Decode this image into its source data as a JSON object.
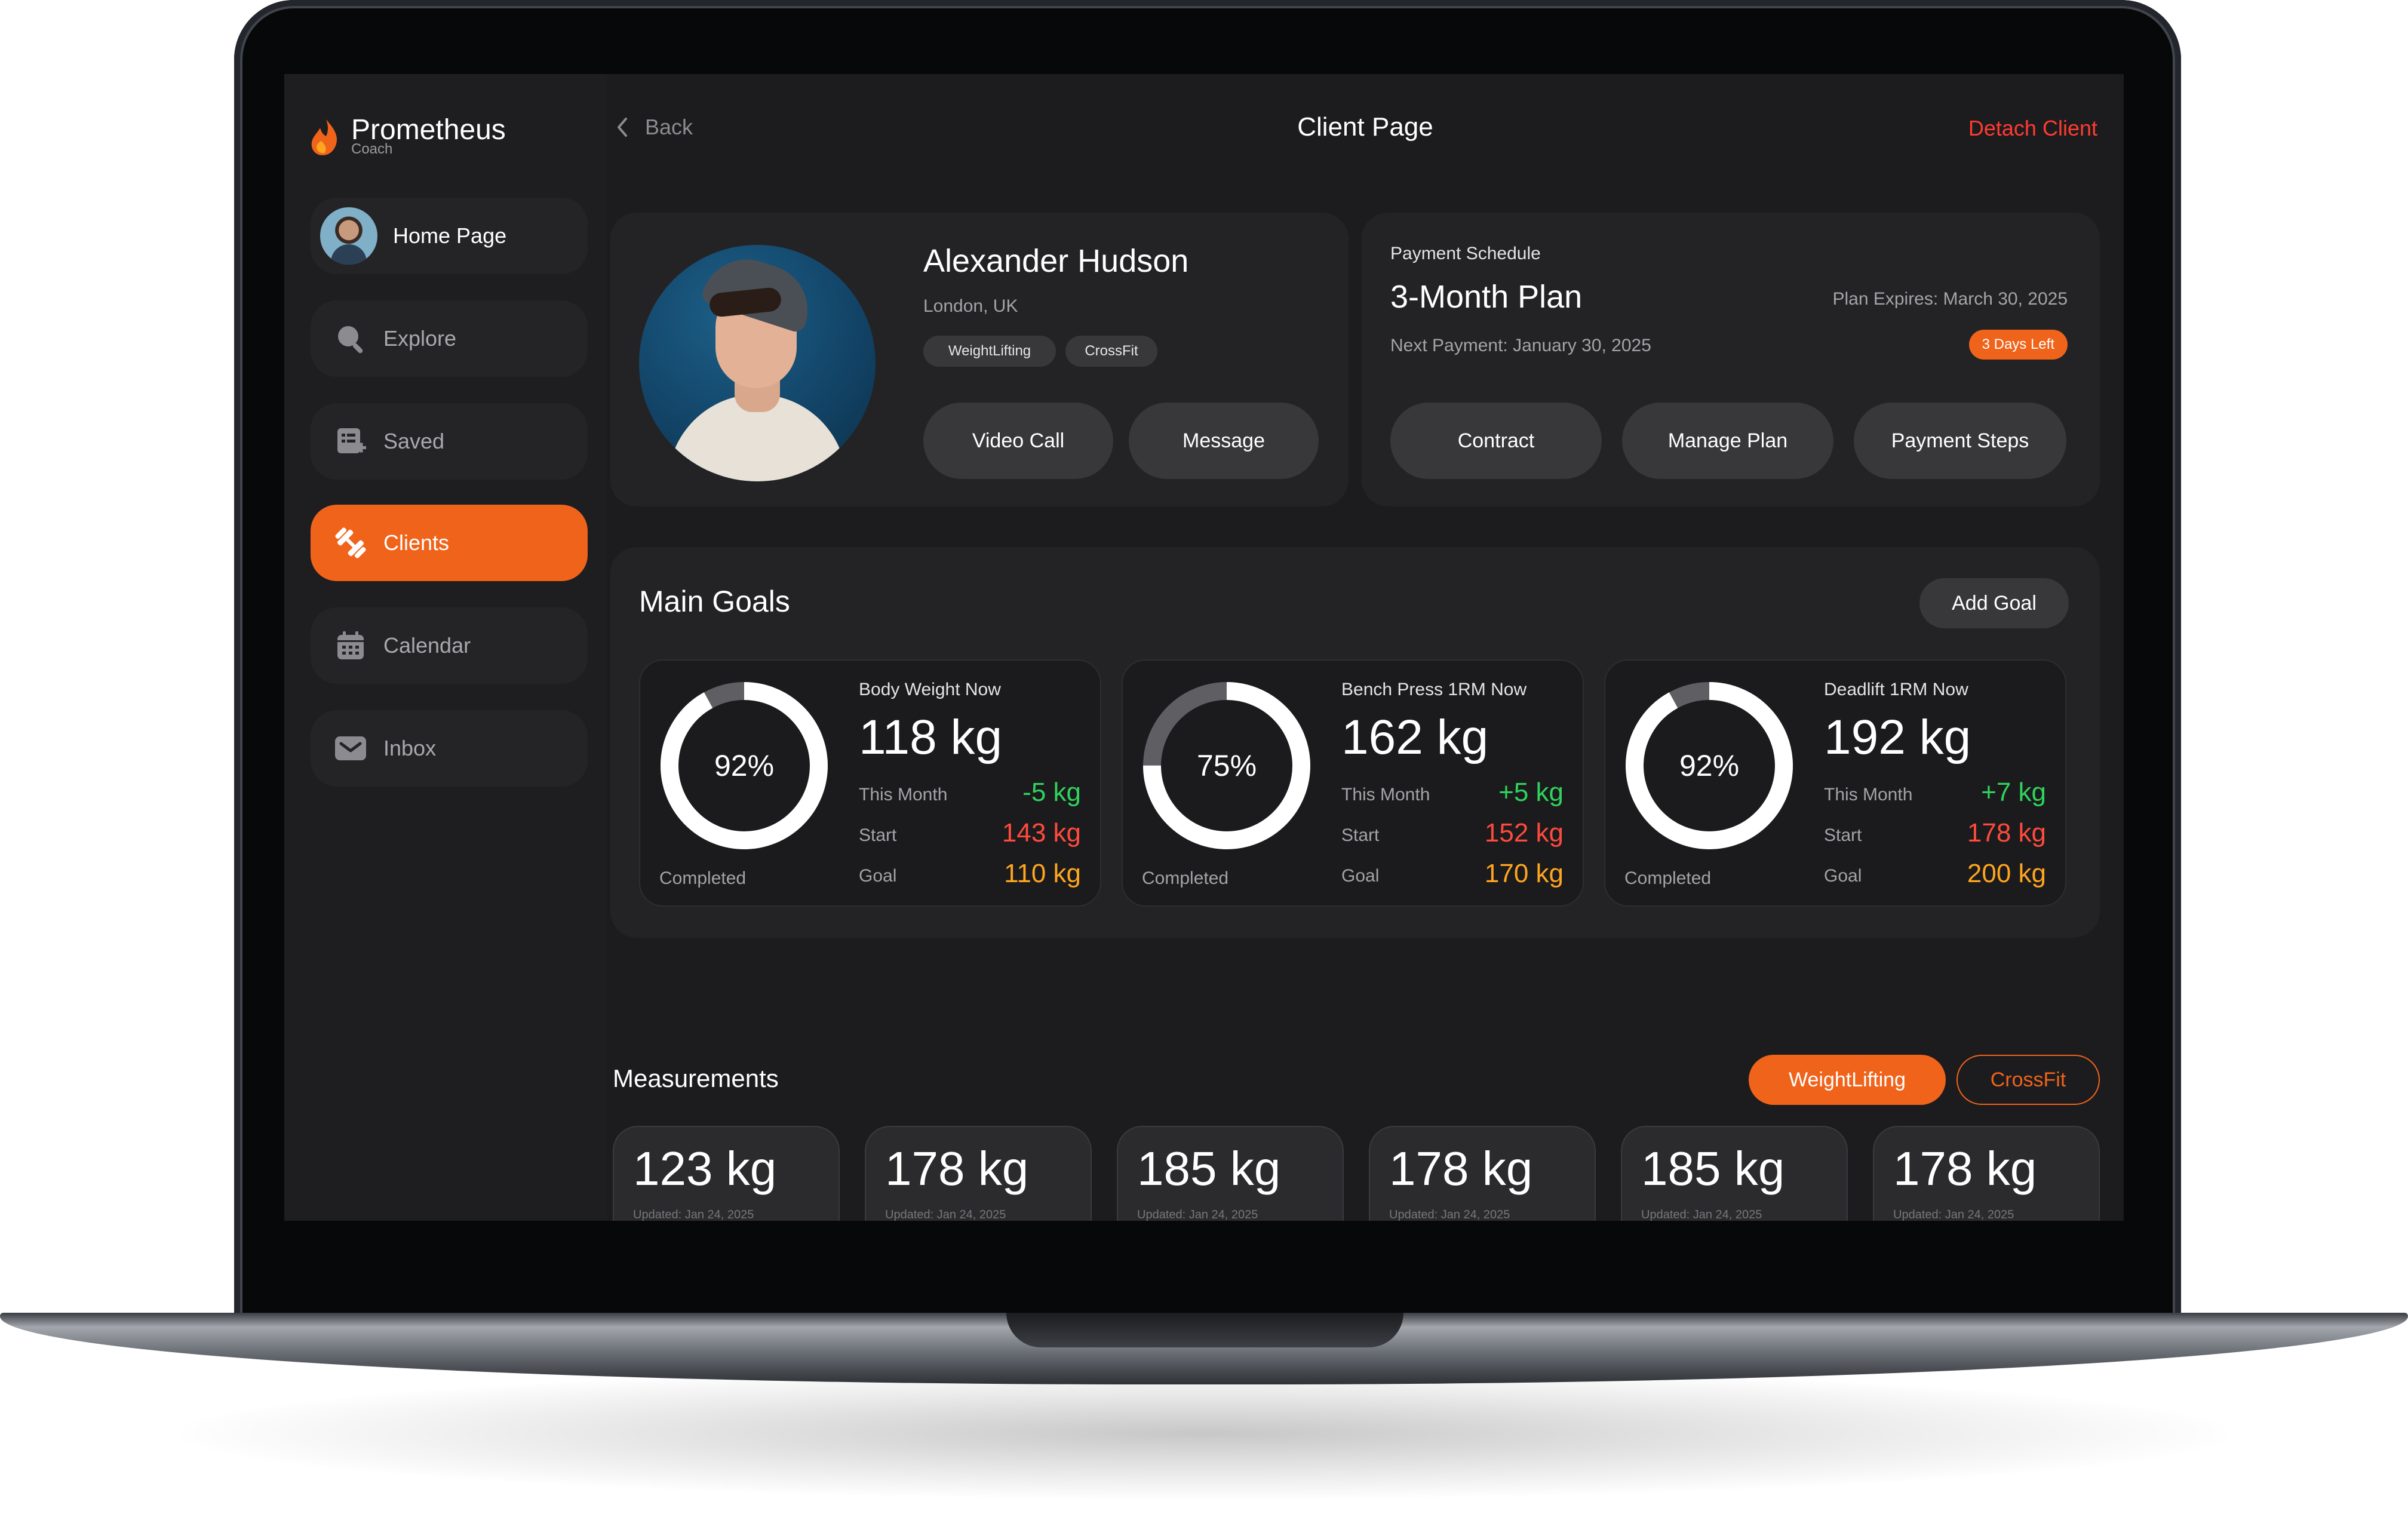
{
  "brand": {
    "name": "Prometheus",
    "sub": "Coach"
  },
  "sidebar": {
    "items": [
      {
        "label": "Home Page"
      },
      {
        "label": "Explore"
      },
      {
        "label": "Saved"
      },
      {
        "label": "Clients"
      },
      {
        "label": "Calendar"
      },
      {
        "label": "Inbox"
      }
    ]
  },
  "header": {
    "back": "Back",
    "title": "Client Page",
    "detach": "Detach Client"
  },
  "client": {
    "name": "Alexander Hudson",
    "location": "London, UK",
    "tags": [
      "WeightLifting",
      "CrossFit"
    ],
    "video_call": "Video Call",
    "message": "Message"
  },
  "payment": {
    "section": "Payment Schedule",
    "plan": "3-Month Plan",
    "expires": "Plan Expires: March 30, 2025",
    "next": "Next Payment: January 30, 2025",
    "badge": "3 Days Left",
    "buttons": [
      "Contract",
      "Manage Plan",
      "Payment Steps"
    ]
  },
  "goals": {
    "title": "Main Goals",
    "add": "Add Goal",
    "items": [
      {
        "label": "Body Weight Now",
        "now": "118 kg",
        "pct_label": "92%",
        "pct": 0.92,
        "completed": "Completed",
        "month_label": "This Month",
        "month": "-5 kg",
        "start_label": "Start",
        "start": "143 kg",
        "goal_label": "Goal",
        "goal": "110 kg"
      },
      {
        "label": "Bench Press 1RM Now",
        "now": "162 kg",
        "pct_label": "75%",
        "pct": 0.75,
        "completed": "Completed",
        "month_label": "This Month",
        "month": "+5 kg",
        "start_label": "Start",
        "start": "152 kg",
        "goal_label": "Goal",
        "goal": "170 kg"
      },
      {
        "label": "Deadlift 1RM Now",
        "now": "192 kg",
        "pct_label": "92%",
        "pct": 0.92,
        "completed": "Completed",
        "month_label": "This Month",
        "month": "+7 kg",
        "start_label": "Start",
        "start": "178 kg",
        "goal_label": "Goal",
        "goal": "200 kg"
      }
    ]
  },
  "measurements": {
    "title": "Measurements",
    "filters": [
      "WeightLifting",
      "CrossFit"
    ],
    "items": [
      {
        "value": "123 kg",
        "updated": "Updated: Jan 24, 2025"
      },
      {
        "value": "178 kg",
        "updated": "Updated: Jan 24, 2025"
      },
      {
        "value": "185 kg",
        "updated": "Updated: Jan 24, 2025"
      },
      {
        "value": "178 kg",
        "updated": "Updated: Jan 24, 2025"
      },
      {
        "value": "185 kg",
        "updated": "Updated: Jan 24, 2025"
      },
      {
        "value": "178 kg",
        "updated": "Updated: Jan 24, 2025"
      }
    ]
  },
  "colors": {
    "accent": "#f0631b",
    "positive": "#2fd35c",
    "negative": "#ff4a3d",
    "goal": "#ffa51f",
    "danger": "#ff3b30"
  }
}
